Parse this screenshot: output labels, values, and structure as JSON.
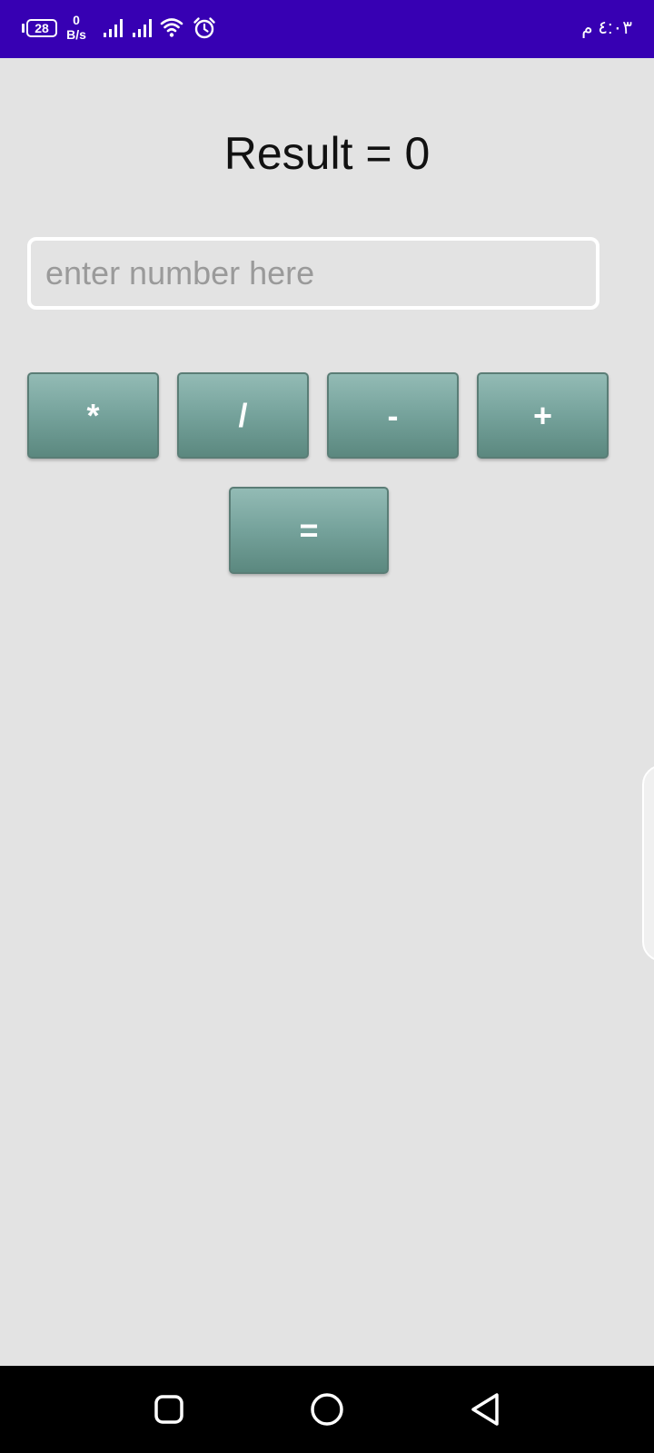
{
  "status_bar": {
    "battery_level": "28",
    "net_speed_value": "0",
    "net_speed_unit": "B/s",
    "time": "٤:٠٣ م",
    "icons": [
      "battery-icon",
      "signal-icon",
      "signal-icon",
      "wifi-icon",
      "alarm-icon"
    ],
    "background_color": "#3700b3"
  },
  "main": {
    "result_text": "Result = 0",
    "input_placeholder": "enter number here",
    "input_value": "",
    "buttons": {
      "multiply": "*",
      "divide": "/",
      "subtract": "-",
      "add": "+",
      "equals": "="
    },
    "button_color": "#75a29b",
    "background_color": "#e3e3e3"
  },
  "nav_bar": {
    "icons": [
      "recents-icon",
      "home-icon",
      "back-icon"
    ]
  }
}
